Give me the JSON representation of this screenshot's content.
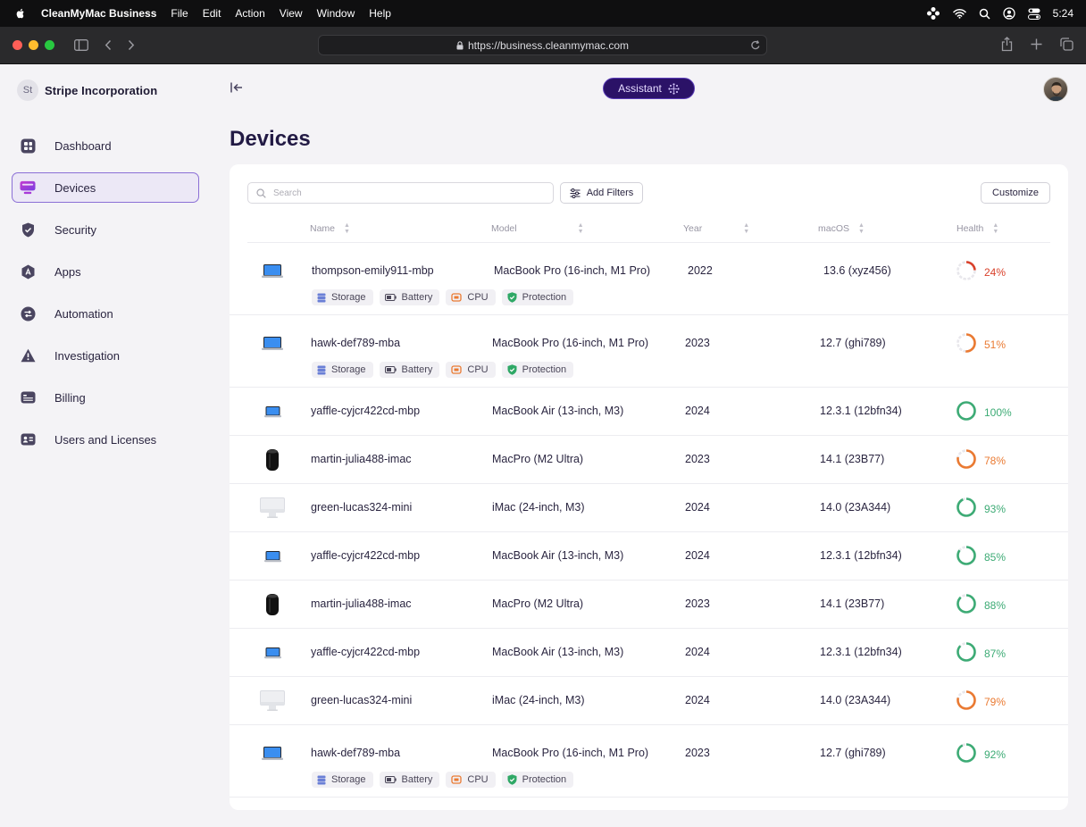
{
  "menubar": {
    "app_name": "CleanMyMac Business",
    "items": [
      "File",
      "Edit",
      "Action",
      "View",
      "Window",
      "Help"
    ],
    "time": "5:24"
  },
  "browser": {
    "url": "https://business.cleanmymac.com"
  },
  "org": {
    "initials": "St",
    "name": "Stripe Incorporation"
  },
  "sidebar": {
    "items": [
      {
        "label": "Dashboard",
        "icon": "dashboard-icon"
      },
      {
        "label": "Devices",
        "icon": "devices-icon",
        "active": true
      },
      {
        "label": "Security",
        "icon": "shield-icon"
      },
      {
        "label": "Apps",
        "icon": "apps-icon"
      },
      {
        "label": "Automation",
        "icon": "automation-icon"
      },
      {
        "label": "Investigation",
        "icon": "warning-icon"
      },
      {
        "label": "Billing",
        "icon": "billing-icon"
      },
      {
        "label": "Users and Licenses",
        "icon": "users-icon"
      }
    ]
  },
  "header": {
    "assistant_label": "Assistant"
  },
  "page": {
    "title": "Devices"
  },
  "toolbar": {
    "search_placeholder": "Search",
    "filters_label": "Add Filters",
    "customize_label": "Customize"
  },
  "table": {
    "columns": [
      "Name",
      "Model",
      "Year",
      "macOS",
      "Health"
    ],
    "tag_labels": [
      "Storage",
      "Battery",
      "CPU",
      "Protection"
    ],
    "colors": {
      "low": "#d9412b",
      "mid": "#ea7a32",
      "good": "#3dab75"
    },
    "rows": [
      {
        "device": "macbook-pro",
        "name": "thompson-emily911-mbp",
        "model": "MacBook Pro (16-inch, M1 Pro)",
        "year": "2022",
        "macos": "13.6 (xyz456)",
        "health": "24%",
        "health_value": 0.24,
        "tags": true
      },
      {
        "device": "macbook-pro",
        "name": "hawk-def789-mba",
        "model": "MacBook Pro (16-inch, M1 Pro)",
        "year": "2023",
        "macos": "12.7 (ghi789)",
        "health": "51%",
        "health_value": 0.51,
        "tags": true
      },
      {
        "device": "macbook-air",
        "name": "yaffle-cyjcr422cd-mbp",
        "model": "MacBook Air (13-inch, M3)",
        "year": "2024",
        "macos": "12.3.1 (12bfn34)",
        "health": "100%",
        "health_value": 1.0,
        "tags": false
      },
      {
        "device": "mac-pro",
        "name": "martin-julia488-imac",
        "model": "MacPro (M2 Ultra)",
        "year": "2023",
        "macos": "14.1 (23B77)",
        "health": "78%",
        "health_value": 0.78,
        "tags": false
      },
      {
        "device": "imac",
        "name": "green-lucas324-mini",
        "model": "iMac (24-inch, M3)",
        "year": "2024",
        "macos": "14.0 (23A344)",
        "health": "93%",
        "health_value": 0.93,
        "tags": false
      },
      {
        "device": "macbook-air",
        "name": "yaffle-cyjcr422cd-mbp",
        "model": "MacBook Air (13-inch, M3)",
        "year": "2024",
        "macos": "12.3.1 (12bfn34)",
        "health": "85%",
        "health_value": 0.85,
        "tags": false
      },
      {
        "device": "mac-pro",
        "name": "martin-julia488-imac",
        "model": "MacPro (M2 Ultra)",
        "year": "2023",
        "macos": "14.1 (23B77)",
        "health": "88%",
        "health_value": 0.88,
        "tags": false
      },
      {
        "device": "macbook-air",
        "name": "yaffle-cyjcr422cd-mbp",
        "model": "MacBook Air (13-inch, M3)",
        "year": "2024",
        "macos": "12.3.1 (12bfn34)",
        "health": "87%",
        "health_value": 0.87,
        "tags": false
      },
      {
        "device": "imac",
        "name": "green-lucas324-mini",
        "model": "iMac (24-inch, M3)",
        "year": "2024",
        "macos": "14.0 (23A344)",
        "health": "79%",
        "health_value": 0.79,
        "tags": false
      },
      {
        "device": "macbook-pro",
        "name": "hawk-def789-mba",
        "model": "MacBook Pro (16-inch, M1 Pro)",
        "year": "2023",
        "macos": "12.7 (ghi789)",
        "health": "92%",
        "health_value": 0.92,
        "tags": true
      }
    ]
  }
}
